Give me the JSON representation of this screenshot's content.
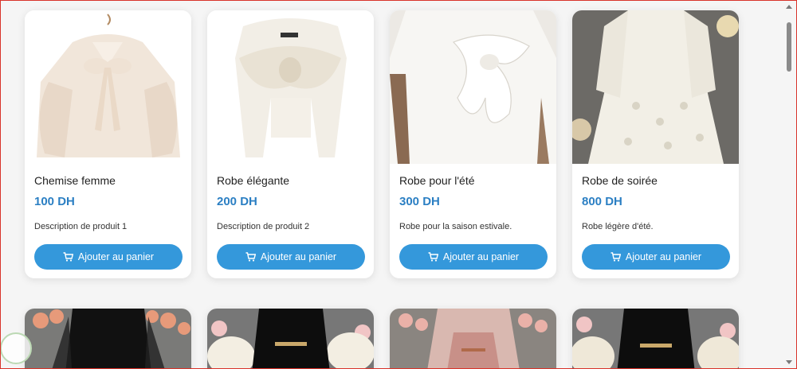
{
  "products": [
    {
      "title": "Chemise femme",
      "price": "100 DH",
      "description": "Description de produit 1",
      "button": "Ajouter au panier",
      "image": "white-blouse-with-bow"
    },
    {
      "title": "Robe élégante",
      "price": "200 DH",
      "description": "Description de produit 2",
      "button": "Ajouter au panier",
      "image": "white-satin-bow-top"
    },
    {
      "title": "Robe pour l'été",
      "price": "300 DH",
      "description": "Robe pour la saison estivale.",
      "button": "Ajouter au panier",
      "image": "white-dress-big-bow"
    },
    {
      "title": "Robe de soirée",
      "price": "800 DH",
      "description": "Robe légère d'été.",
      "button": "Ajouter au panier",
      "image": "white-lace-dress"
    }
  ],
  "second_row_images": [
    "black-dress-flowers",
    "black-dress-belt",
    "pink-lace-dress",
    "black-dress-belt-2"
  ],
  "icons": {
    "cart": "cart-icon"
  },
  "colors": {
    "accent": "#3498db",
    "price": "#2b7fc3",
    "frame": "#d9342b"
  }
}
